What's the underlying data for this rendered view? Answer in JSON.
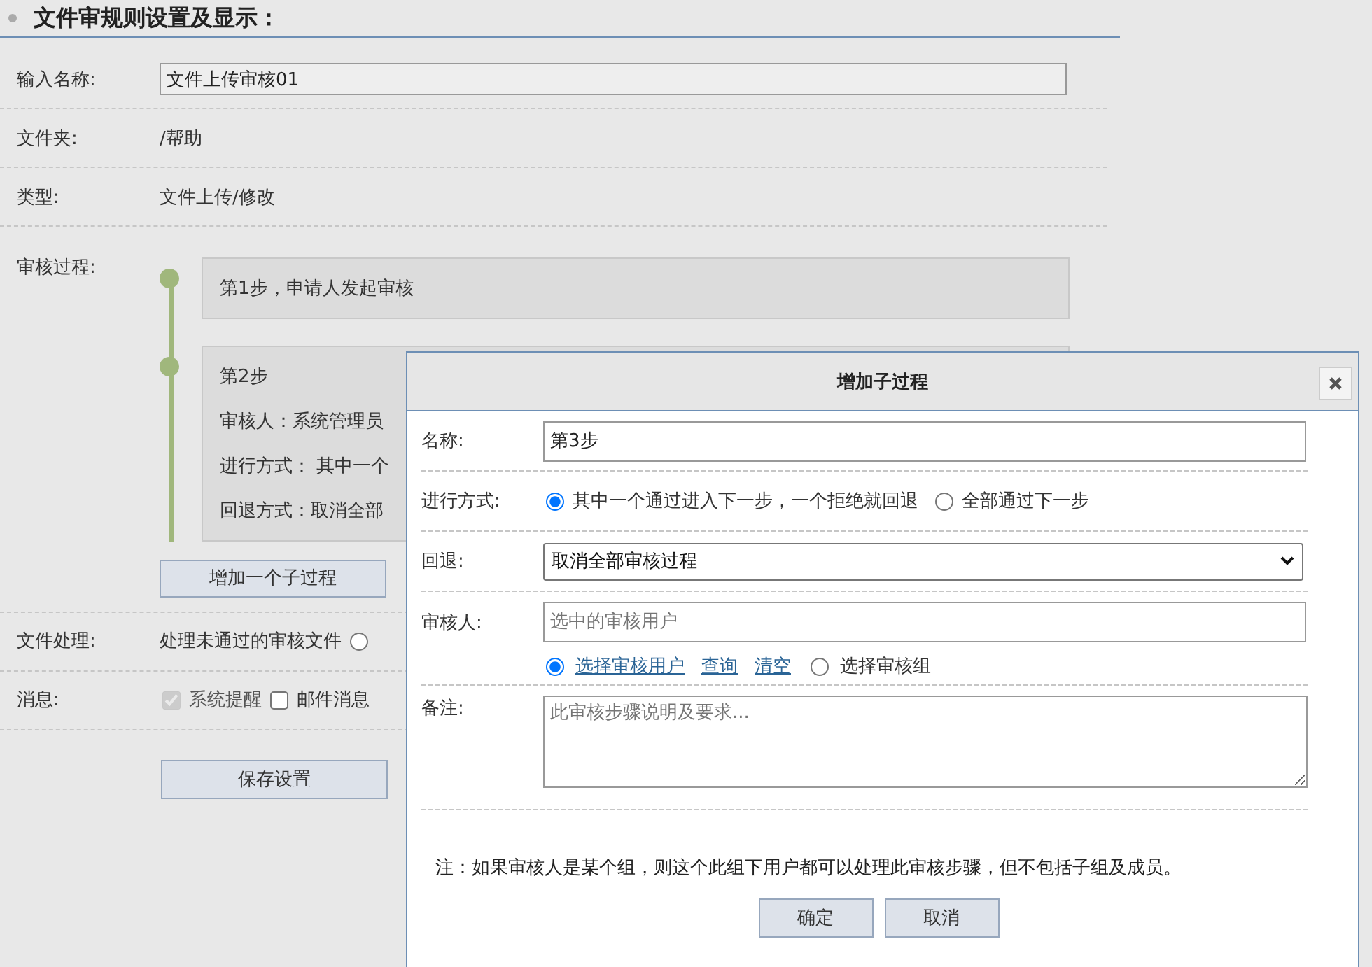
{
  "header": {
    "title": "文件审规则设置及显示："
  },
  "form": {
    "name": {
      "label": "输入名称:",
      "value": "文件上传审核01"
    },
    "folder": {
      "label": "文件夹:",
      "value": "/帮助"
    },
    "type": {
      "label": "类型:",
      "value": "文件上传/修改"
    },
    "process": {
      "label": "审核过程:",
      "steps": [
        {
          "lines": [
            "第1步，申请人发起审核"
          ]
        },
        {
          "lines": [
            "第2步",
            "审核人：系统管理员",
            "进行方式： 其中一个",
            "回退方式：取消全部"
          ]
        }
      ],
      "add_button": "增加一个子过程"
    },
    "file_handling": {
      "label": "文件处理:",
      "text": "处理未通过的审核文件",
      "options": [
        {
          "selected": false
        }
      ]
    },
    "message": {
      "label": "消息:",
      "options": [
        {
          "label": "系统提醒",
          "checked": true,
          "disabled": true
        },
        {
          "label": "邮件消息",
          "checked": false,
          "disabled": false
        }
      ]
    },
    "save_button": "保存设置"
  },
  "dialog": {
    "title": "增加子过程",
    "name": {
      "label": "名称:",
      "value": "第3步"
    },
    "mode": {
      "label": "进行方式:",
      "options": [
        {
          "label": "其中一个通过进入下一步，一个拒绝就回退",
          "selected": true
        },
        {
          "label": "全部通过下一步",
          "selected": false
        }
      ]
    },
    "rollback": {
      "label": "回退:",
      "value": "取消全部审核过程"
    },
    "reviewer": {
      "label": "审核人:",
      "placeholder": "选中的审核用户",
      "choices": [
        {
          "kind": "links",
          "selected": true,
          "links": [
            "选择审核用户",
            "查询",
            "清空"
          ]
        },
        {
          "kind": "label",
          "selected": false,
          "label": "选择审核组"
        }
      ]
    },
    "remark": {
      "label": "备注:",
      "placeholder": "此审核步骤说明及要求..."
    },
    "note": "注：如果审核人是某个组，则这个此组下用户都可以处理此审核步骤，但不包括子组及成员。",
    "buttons": [
      "确定",
      "取消"
    ]
  }
}
